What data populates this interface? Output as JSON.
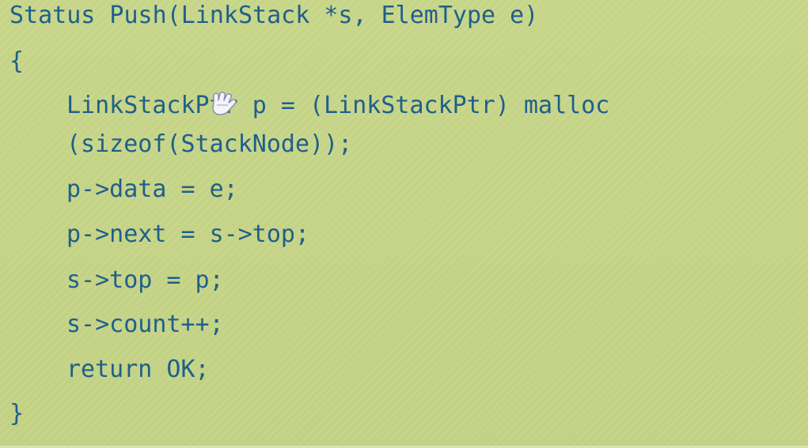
{
  "code": {
    "lines": [
      "Status Push(LinkStack *s, ElemType e)",
      "{",
      "LinkStackPtr p = (LinkStackPtr) malloc",
      "(sizeof(StackNode));",
      "p->data = e;",
      "p->next = s->top;",
      "s->top = p;",
      "s->count++;",
      "return OK;",
      "}"
    ]
  },
  "colors": {
    "background": "#c4d386",
    "text": "#1f5f8b"
  },
  "icons": {
    "cursor": "hand-pointer-icon"
  }
}
